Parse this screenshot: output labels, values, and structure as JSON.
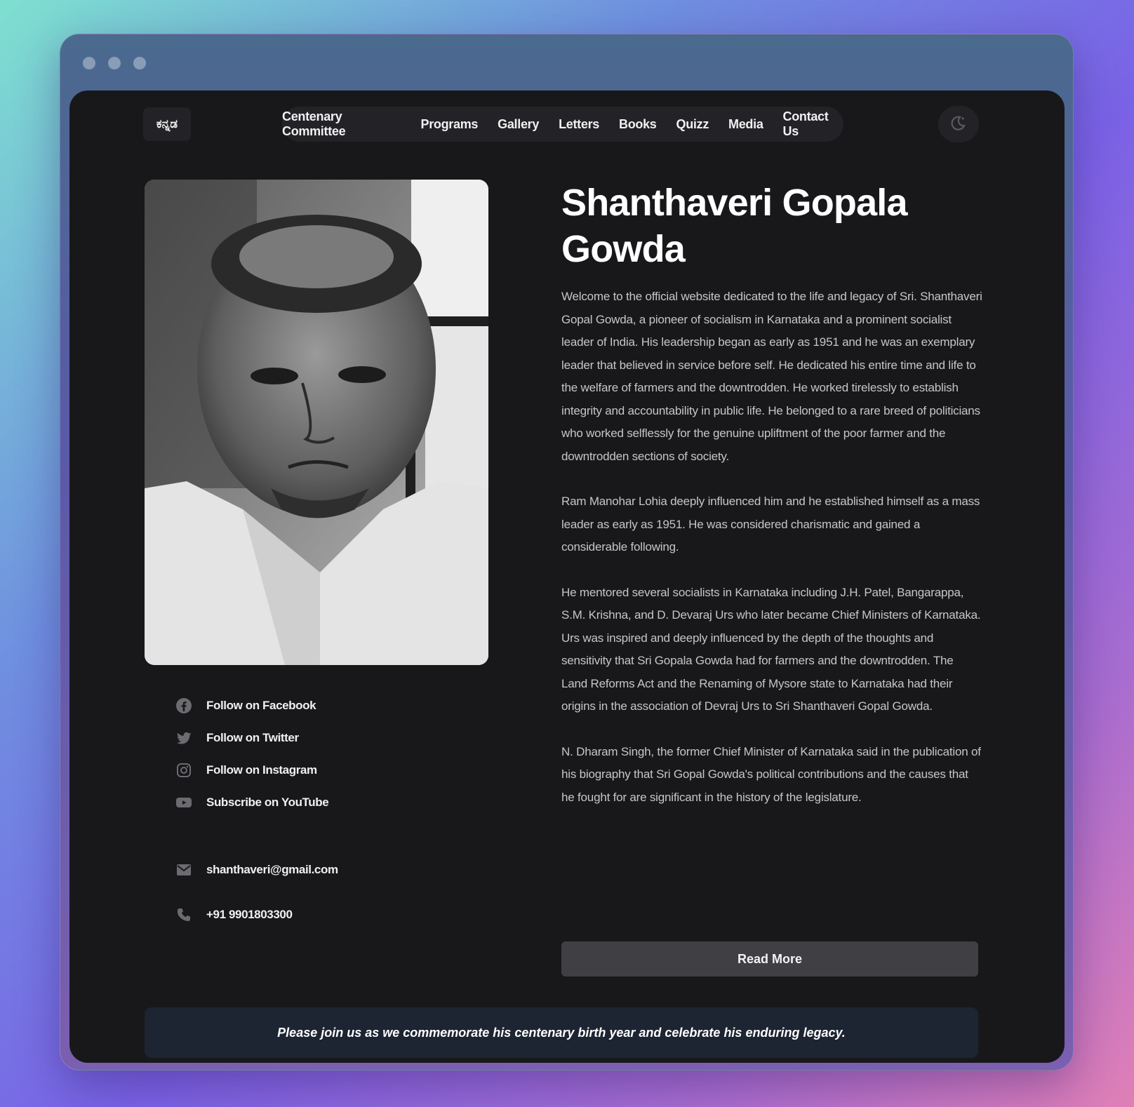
{
  "header": {
    "language_toggle": "ಕನ್ನಡ",
    "nav": [
      "Centenary Committee",
      "Programs",
      "Gallery",
      "Letters",
      "Books",
      "Quizz",
      "Media",
      "Contact Us"
    ],
    "theme_icon": "moon-icon"
  },
  "portrait": {
    "icon": "portrait-photo"
  },
  "social": [
    {
      "label": "Follow on Facebook",
      "icon": "facebook-icon"
    },
    {
      "label": "Follow on Twitter",
      "icon": "twitter-icon"
    },
    {
      "label": "Follow on Instagram",
      "icon": "instagram-icon"
    },
    {
      "label": "Subscribe on YouTube",
      "icon": "youtube-icon"
    }
  ],
  "contact": {
    "email": "shanthaveri@gmail.com",
    "phone": "+91 9901803300"
  },
  "main": {
    "title": "Shanthaveri Gopala Gowda",
    "paragraphs": [
      "Welcome to the official website dedicated to the life and legacy of Sri. Shanthaveri Gopal Gowda, a pioneer of socialism in Karnataka and a prominent socialist leader of India. His leadership began as early as 1951 and he was an exemplary leader that believed in service before self. He dedicated his entire time and life to the welfare of farmers and the downtrodden. He worked tirelessly to establish integrity and accountability in public life. He belonged to a rare breed of politicians who worked selflessly for the genuine upliftment of the poor farmer and the downtrodden sections of society.",
      "Ram Manohar Lohia deeply influenced him and he established himself as a mass leader as early as 1951. He was considered charismatic and gained a considerable following.",
      "He mentored several socialists in Karnataka including J.H. Patel, Bangarappa, S.M. Krishna, and D. Devaraj Urs who later became Chief Ministers of Karnataka. Urs was inspired and deeply influenced by the depth of the thoughts and sensitivity that Sri Gopala Gowda had for farmers and the downtrodden. The Land Reforms Act and the Renaming of Mysore state to Karnataka had their origins in the association of Devraj Urs to Sri Shanthaveri Gopal Gowda.",
      "N. Dharam Singh, the former Chief Minister of Karnataka said in the publication of his biography that Sri Gopal Gowda's political contributions and the causes that he fought for are significant in the history of the legislature."
    ],
    "read_more": "Read More"
  },
  "banner": "Please join us as we commemorate his centenary birth year and celebrate his enduring legacy."
}
